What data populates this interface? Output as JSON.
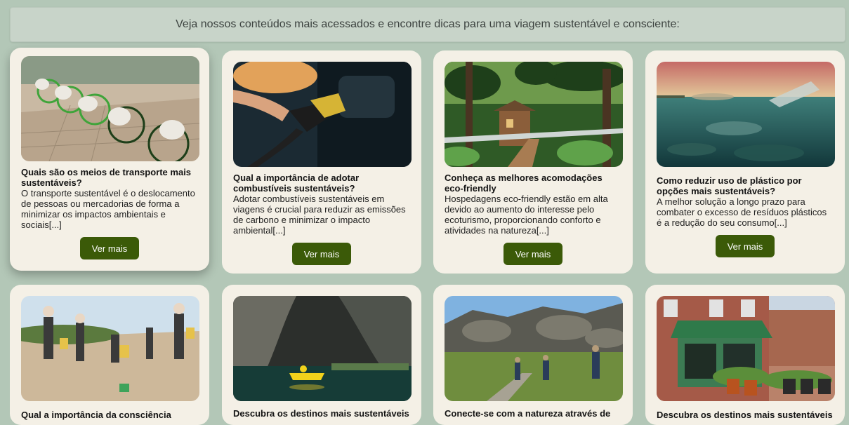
{
  "banner": {
    "text": "Veja nossos conteúdos mais acessados e encontre dicas para uma viagem sustentável e consciente:"
  },
  "cards": [
    {
      "title": "Quais são os meios de transporte mais sustentáveis?",
      "description": "O transporte sustentável é o deslocamento de pessoas ou mercadorias de forma a minimizar os impactos ambientais e sociais[...]",
      "button": "Ver mais",
      "image": "bicycle-sharing-station"
    },
    {
      "title": "Qual a importância de adotar combustíveis sustentáveis?",
      "description": "Adotar combustíveis sustentáveis em viagens é crucial para reduzir as emissões de carbono e minimizar o impacto ambiental[...]",
      "button": "Ver mais",
      "image": "fuel-nozzle-refueling"
    },
    {
      "title": "Conheça as melhores acomodações eco-friendly",
      "description": "Hospedagens eco-friendly estão em alta devido ao aumento do interesse pelo ecoturismo, proporcionando conforto e atividades na natureza[...]",
      "button": "Ver mais",
      "image": "jungle-treehouse-lodge"
    },
    {
      "title": "Como reduzir uso de plástico por opções mais sustentáveis?",
      "description": "A melhor solução a longo prazo para combater o excesso de resíduos plásticos é a redução do seu consumo[...]",
      "button": "Ver mais",
      "image": "plastic-bottle-in-ocean"
    },
    {
      "title": "Qual a importância da consciência",
      "image": "beach-cleanup-volunteers"
    },
    {
      "title": "Descubra os destinos mais sustentáveis",
      "image": "cave-kayak-lake"
    },
    {
      "title": "Conecte-se com a natureza através de",
      "image": "hiking-trail-rocks"
    },
    {
      "title": "Descubra os destinos mais sustentáveis",
      "image": "green-storefront-plants"
    }
  ]
}
